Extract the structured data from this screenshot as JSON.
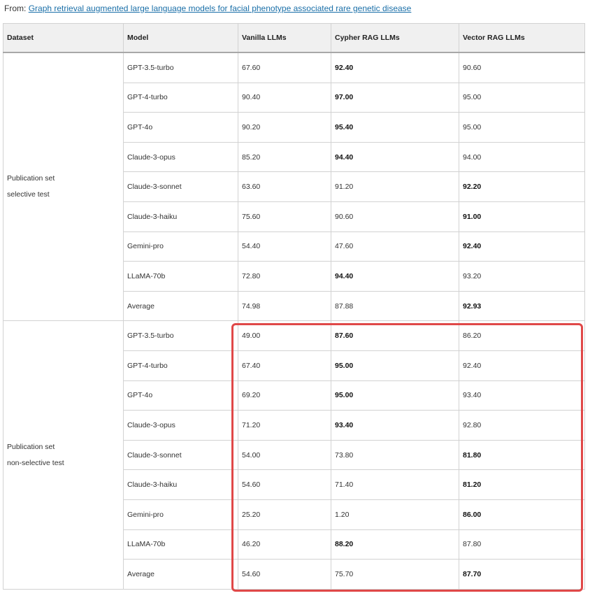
{
  "source": {
    "prefix": "From:",
    "link_text": "Graph retrieval augmented large language models for facial phenotype associated rare genetic disease"
  },
  "table": {
    "headers": [
      "Dataset",
      "Model",
      "Vanilla LLMs",
      "Cypher RAG LLMs",
      "Vector RAG LLMs"
    ],
    "groups": [
      {
        "dataset_line1": "Publication set",
        "dataset_line2": "selective test",
        "rows": [
          {
            "model": "GPT-3.5-turbo",
            "vanilla": "67.60",
            "cypher": "92.40",
            "vector": "90.60",
            "best": "cypher"
          },
          {
            "model": "GPT-4-turbo",
            "vanilla": "90.40",
            "cypher": "97.00",
            "vector": "95.00",
            "best": "cypher"
          },
          {
            "model": "GPT-4o",
            "vanilla": "90.20",
            "cypher": "95.40",
            "vector": "95.00",
            "best": "cypher"
          },
          {
            "model": "Claude-3-opus",
            "vanilla": "85.20",
            "cypher": "94.40",
            "vector": "94.00",
            "best": "cypher"
          },
          {
            "model": "Claude-3-sonnet",
            "vanilla": "63.60",
            "cypher": "91.20",
            "vector": "92.20",
            "best": "vector"
          },
          {
            "model": "Claude-3-haiku",
            "vanilla": "75.60",
            "cypher": "90.60",
            "vector": "91.00",
            "best": "vector"
          },
          {
            "model": "Gemini-pro",
            "vanilla": "54.40",
            "cypher": "47.60",
            "vector": "92.40",
            "best": "vector"
          },
          {
            "model": "LLaMA-70b",
            "vanilla": "72.80",
            "cypher": "94.40",
            "vector": "93.20",
            "best": "cypher"
          },
          {
            "model": "Average",
            "vanilla": "74.98",
            "cypher": "87.88",
            "vector": "92.93",
            "best": "vector"
          }
        ]
      },
      {
        "dataset_line1": "Publication set",
        "dataset_line2": "non-selective test",
        "rows": [
          {
            "model": "GPT-3.5-turbo",
            "vanilla": "49.00",
            "cypher": "87.60",
            "vector": "86.20",
            "best": "cypher"
          },
          {
            "model": "GPT-4-turbo",
            "vanilla": "67.40",
            "cypher": "95.00",
            "vector": "92.40",
            "best": "cypher"
          },
          {
            "model": "GPT-4o",
            "vanilla": "69.20",
            "cypher": "95.00",
            "vector": "93.40",
            "best": "cypher"
          },
          {
            "model": "Claude-3-opus",
            "vanilla": "71.20",
            "cypher": "93.40",
            "vector": "92.80",
            "best": "cypher"
          },
          {
            "model": "Claude-3-sonnet",
            "vanilla": "54.00",
            "cypher": "73.80",
            "vector": "81.80",
            "best": "vector"
          },
          {
            "model": "Claude-3-haiku",
            "vanilla": "54.60",
            "cypher": "71.40",
            "vector": "81.20",
            "best": "vector"
          },
          {
            "model": "Gemini-pro",
            "vanilla": "25.20",
            "cypher": "1.20",
            "vector": "86.00",
            "best": "vector"
          },
          {
            "model": "LLaMA-70b",
            "vanilla": "46.20",
            "cypher": "88.20",
            "vector": "87.80",
            "best": "cypher"
          },
          {
            "model": "Average",
            "vanilla": "54.60",
            "cypher": "75.70",
            "vector": "87.70",
            "best": "vector"
          }
        ]
      }
    ]
  },
  "highlight": {
    "color": "#e04848"
  }
}
